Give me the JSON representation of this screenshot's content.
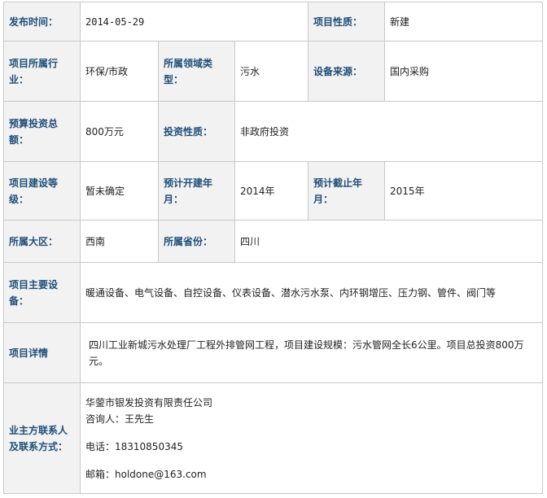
{
  "rows": {
    "publish": {
      "label": "发布时间：",
      "value": "2014-05-29",
      "nature_label": "项目性质：",
      "nature_value": "新建"
    },
    "industry": {
      "label": "项目所属行业：",
      "value": "环保/市政",
      "field_label": "所属领域类型：",
      "field_value": "污水",
      "source_label": "设备来源：",
      "source_value": "国内采购"
    },
    "budget": {
      "label": "预算投资总额：",
      "value": "800万元",
      "invest_label": "投资性质：",
      "invest_value": "非政府投资"
    },
    "level": {
      "label": "项目建设等级：",
      "value": "暂未确定",
      "start_label": "预计开建年月：",
      "start_value": "2014年",
      "end_label": "预计截止年月：",
      "end_value": "2015年"
    },
    "region": {
      "label": "所属大区：",
      "value": "西南",
      "province_label": "所属省份：",
      "province_value": "四川"
    },
    "equipment": {
      "label": "项目主要设备：",
      "value": "暖通设备、电气设备、自控设备、仪表设备、潜水污水泵、内环钢增压、压力钢、管件、阀门等"
    },
    "detail": {
      "label": "项目详情",
      "value": "四川工业新城污水处理厂工程外排管网工程，项目建设规模：污水管网全长6公里。项目总投资800万元。"
    },
    "contact": {
      "label": "业主方联系人及联系方式：",
      "company": "华蓥市银发投资有限责任公司",
      "consultant": "咨询人：王先生",
      "phone": "电话：18310850345",
      "email": "邮箱：holdone@163.com"
    }
  }
}
